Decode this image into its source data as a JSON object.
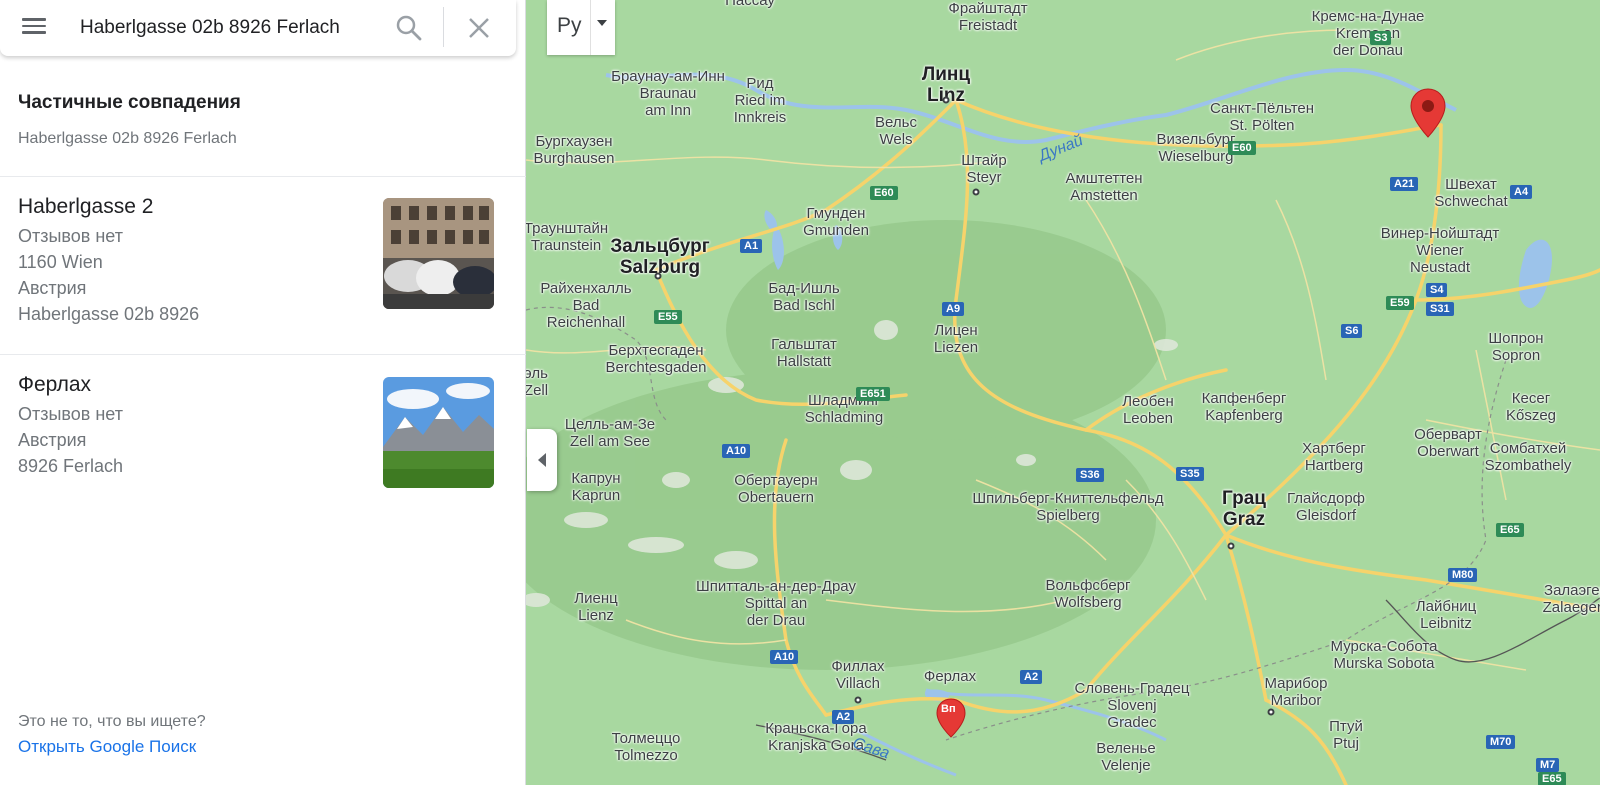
{
  "search": {
    "query": "Haberlgasse 02b 8926 Ferlach"
  },
  "partial_matches": {
    "title": "Частичные совпадения",
    "subtitle": "Haberlgasse 02b 8926 Ferlach"
  },
  "results": [
    {
      "title": "Haberlgasse 2",
      "lines": [
        "Отзывов нет",
        "1160 Wien",
        "Австрия",
        "Haberlgasse 02b 8926"
      ]
    },
    {
      "title": "Ферлах",
      "lines": [
        "Отзывов нет",
        "Австрия",
        "8926 Ferlach"
      ]
    }
  ],
  "footer": {
    "not_found": "Это не то, что вы ищете?",
    "google_link": "Открыть Google Поиск"
  },
  "map": {
    "layer_button_label": "Ру",
    "pin_marker_label": "Вп",
    "colors": {
      "land": "#a8d8a0",
      "road": "#f6d36b",
      "water": "#9cc3ea",
      "pin": "#e53935",
      "link": "#1a73e8"
    },
    "places": [
      {
        "id": "freistadt",
        "lines": [
          "Фрайштадт",
          "Freistadt"
        ]
      },
      {
        "id": "krems",
        "lines": [
          "Кремс-на-Дунае",
          "Krems an",
          "der Donau"
        ]
      },
      {
        "id": "braunau",
        "lines": [
          "Браунау-ам-Инн",
          "Braunau",
          "am Inn"
        ]
      },
      {
        "id": "ried",
        "lines": [
          "Рид",
          "Ried im",
          "Innkreis"
        ]
      },
      {
        "id": "linz",
        "lines": [
          "Линц",
          "Linz"
        ],
        "big": true
      },
      {
        "id": "stpoelten",
        "lines": [
          "Санкт-Пёльтен",
          "St. Pölten"
        ]
      },
      {
        "id": "burghausen",
        "lines": [
          "Бургхаузен",
          "Burghausen"
        ]
      },
      {
        "id": "wels",
        "lines": [
          "Вельс",
          "Wels"
        ]
      },
      {
        "id": "steyr",
        "lines": [
          "Штайр",
          "Steyr"
        ]
      },
      {
        "id": "amstetten",
        "lines": [
          "Амштеттен",
          "Amstetten"
        ]
      },
      {
        "id": "wieselburg",
        "lines": [
          "Визельбург",
          "Wieselburg"
        ]
      },
      {
        "id": "schwechat",
        "lines": [
          "Швехат",
          "Schwechat"
        ]
      },
      {
        "id": "gmunden",
        "lines": [
          "Гмунден",
          "Gmunden"
        ]
      },
      {
        "id": "traunstein",
        "lines": [
          "Траунштайн",
          "Traunstein"
        ]
      },
      {
        "id": "salzburg",
        "lines": [
          "Зальцбург",
          "Salzburg"
        ],
        "big": true
      },
      {
        "id": "wrneustadt",
        "lines": [
          "Винер-Нойштадт",
          "Wiener",
          "Neustadt"
        ]
      },
      {
        "id": "reichenhall",
        "lines": [
          "Райхенхалль",
          "Bad",
          "Reichenhall"
        ]
      },
      {
        "id": "badischl",
        "lines": [
          "Бад-Ишль",
          "Bad Ischl"
        ]
      },
      {
        "id": "hallstatt",
        "lines": [
          "Гальштат",
          "Hallstatt"
        ]
      },
      {
        "id": "liezen",
        "lines": [
          "Лицен",
          "Liezen"
        ]
      },
      {
        "id": "berchtesgaden",
        "lines": [
          "Берхтесгаден",
          "Berchtesgaden"
        ]
      },
      {
        "id": "sopron",
        "lines": [
          "Шопрон",
          "Sopron"
        ]
      },
      {
        "id": "schladming",
        "lines": [
          "Шладминг",
          "Schladming"
        ]
      },
      {
        "id": "leoben",
        "lines": [
          "Леобен",
          "Leoben"
        ]
      },
      {
        "id": "kapfenberg",
        "lines": [
          "Капфенберг",
          "Kapfenberg"
        ]
      },
      {
        "id": "koszeg",
        "lines": [
          "Кесег",
          "Kőszeg"
        ]
      },
      {
        "id": "zellamsee",
        "lines": [
          "Целль-ам-Зе",
          "Zell am See"
        ]
      },
      {
        "id": "oberwart",
        "lines": [
          "Оберварт",
          "Oberwart"
        ]
      },
      {
        "id": "szombathely",
        "lines": [
          "Сомбатхей",
          "Szombathely"
        ]
      },
      {
        "id": "kaprun",
        "lines": [
          "Капрун",
          "Kaprun"
        ]
      },
      {
        "id": "obertauern",
        "lines": [
          "Обертауерн",
          "Obertauern"
        ]
      },
      {
        "id": "hartberg",
        "lines": [
          "Хартберг",
          "Hartberg"
        ]
      },
      {
        "id": "spielberg",
        "lines": [
          "Шпильберг-Книттельфельд",
          "Spielberg"
        ]
      },
      {
        "id": "graz",
        "lines": [
          "Грац",
          "Graz"
        ],
        "big": true
      },
      {
        "id": "gleisdorf",
        "lines": [
          "Глайсдорф",
          "Gleisdorf"
        ]
      },
      {
        "id": "spittal",
        "lines": [
          "Шпитталь-ан-дер-Драу",
          "Spittal an",
          "der Drau"
        ]
      },
      {
        "id": "wolfsberg",
        "lines": [
          "Вольфсберг",
          "Wolfsberg"
        ]
      },
      {
        "id": "lienz",
        "lines": [
          "Лиенц",
          "Lienz"
        ]
      },
      {
        "id": "leibnitz",
        "lines": [
          "Лайбниц",
          "Leibnitz"
        ]
      },
      {
        "id": "zalaeg",
        "lines": [
          "Залаэгер",
          "Zalaegers"
        ]
      },
      {
        "id": "villach",
        "lines": [
          "Филлах",
          "Villach"
        ]
      },
      {
        "id": "ferlach",
        "lines": [
          "Ферлах"
        ]
      },
      {
        "id": "msobota",
        "lines": [
          "Мурска-Собота",
          "Murska Sobota"
        ]
      },
      {
        "id": "maribor",
        "lines": [
          "Марибор",
          "Maribor"
        ]
      },
      {
        "id": "slovenjgradec",
        "lines": [
          "Словень-Градец",
          "Slovenj",
          "Gradec"
        ]
      },
      {
        "id": "tolmezzo",
        "lines": [
          "Толмеццо",
          "Tolmezzo"
        ]
      },
      {
        "id": "kranjska",
        "lines": [
          "Краньска-Гора",
          "Kranjska Gora"
        ]
      },
      {
        "id": "ptuj",
        "lines": [
          "Птуй",
          "Ptuj"
        ]
      },
      {
        "id": "velenje",
        "lines": [
          "Веленье",
          "Velenje"
        ]
      },
      {
        "id": "passau",
        "lines": [
          "Пассау"
        ]
      },
      {
        "id": "edge_l",
        "lines": [
          "эль",
          "Zell"
        ]
      }
    ],
    "water_labels": [
      "Дунай",
      "Сава"
    ],
    "roads": [
      {
        "id": "S3",
        "label": "S3",
        "style": "green"
      },
      {
        "id": "E60a",
        "label": "E60",
        "style": "green"
      },
      {
        "id": "E60b",
        "label": "E60",
        "style": "green"
      },
      {
        "id": "A21",
        "label": "A21",
        "style": "blue"
      },
      {
        "id": "A4",
        "label": "A4",
        "style": "blue"
      },
      {
        "id": "A1",
        "label": "A1",
        "style": "blue"
      },
      {
        "id": "A9",
        "label": "A9",
        "style": "blue"
      },
      {
        "id": "E55",
        "label": "E55",
        "style": "green"
      },
      {
        "id": "E59",
        "label": "E59",
        "style": "green"
      },
      {
        "id": "S4",
        "label": "S4",
        "style": "blue"
      },
      {
        "id": "S31",
        "label": "S31",
        "style": "blue"
      },
      {
        "id": "S6",
        "label": "S6",
        "style": "blue"
      },
      {
        "id": "E651",
        "label": "E651",
        "style": "green"
      },
      {
        "id": "A10a",
        "label": "A10",
        "style": "blue"
      },
      {
        "id": "S36",
        "label": "S36",
        "style": "blue"
      },
      {
        "id": "S35",
        "label": "S35",
        "style": "blue"
      },
      {
        "id": "E65",
        "label": "E65",
        "style": "green"
      },
      {
        "id": "M80",
        "label": "M80",
        "style": "blue"
      },
      {
        "id": "A10b",
        "label": "A10",
        "style": "blue"
      },
      {
        "id": "A2a",
        "label": "A2",
        "style": "blue"
      },
      {
        "id": "A2b",
        "label": "A2",
        "style": "blue"
      },
      {
        "id": "M70",
        "label": "M70",
        "style": "blue"
      },
      {
        "id": "M7",
        "label": "M7",
        "style": "blue"
      },
      {
        "id": "E65b",
        "label": "E65",
        "style": "green"
      }
    ]
  }
}
